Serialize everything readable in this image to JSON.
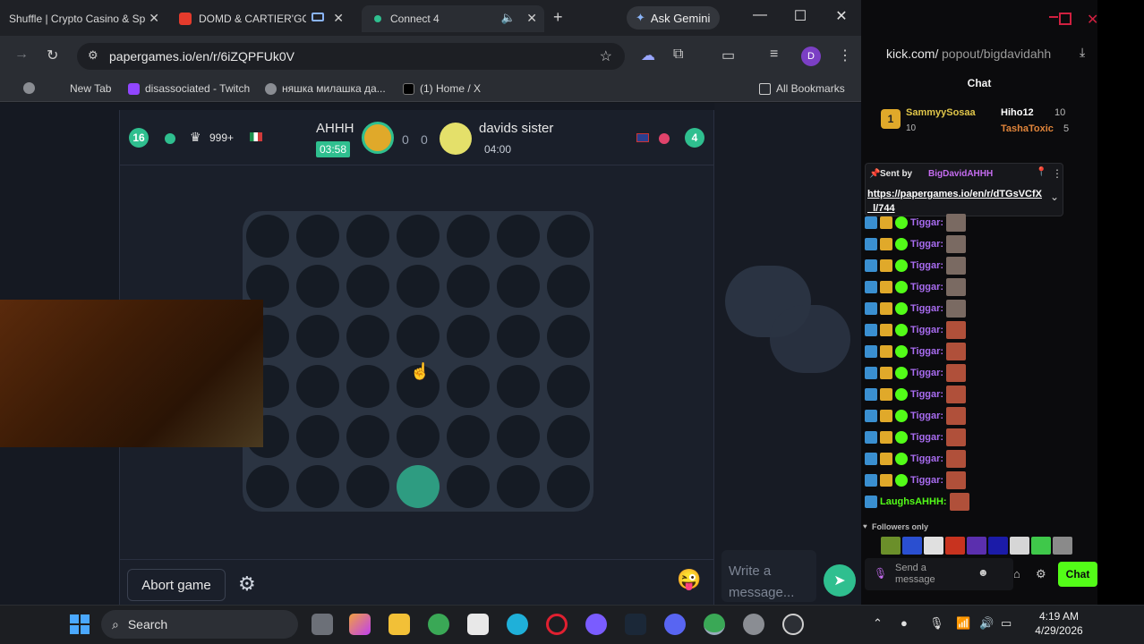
{
  "browser": {
    "tabs": [
      {
        "label": "Shuffle | Crypto Casino & Sp",
        "favicon_color": "#7a5cff"
      },
      {
        "label": "DOMD & CARTIER'GOD",
        "favicon_color": "#e53b2c"
      },
      {
        "label": "Connect 4",
        "favicon_color": "#2fbf8f"
      }
    ],
    "ask_gemini": "Ask Gemini",
    "url": "papergames.io/en/r/6iZQPFUk0V",
    "profile_initial": "D",
    "bookmarks": [
      {
        "label": "New Tab"
      },
      {
        "label": "disassociated - Twitch"
      },
      {
        "label": "няшка милашка да..."
      },
      {
        "label": "(1) Home / X"
      }
    ],
    "all_bookmarks": "All Bookmarks"
  },
  "game": {
    "player1": {
      "level": "16",
      "crown": "999+",
      "name": "AHHH",
      "timer": "03:58",
      "score": "0"
    },
    "player2": {
      "level": "4",
      "name": "davids sister",
      "timer": "04:00",
      "score": "0"
    },
    "board": {
      "rows": 6,
      "cols": 7,
      "pieces": [
        {
          "row": 5,
          "col": 3,
          "color": "teal"
        }
      ]
    },
    "abort_label": "Abort game",
    "chat_placeholder": "Write a message..."
  },
  "kick": {
    "url_prefix": "kick.com/",
    "url_path": "popout/bigdavidahh",
    "title": "Chat",
    "leaderboard": [
      {
        "rank": "1",
        "name": "SammyySosaa",
        "points": "10"
      },
      {
        "name": "Hiho12",
        "points": "10"
      },
      {
        "name": "TashaToxic",
        "points": "5"
      }
    ],
    "pinned": {
      "sent_by_label": "Sent by",
      "sender": "BigDavidAHHH",
      "link": "https://papergames.io/en/r/dTGsVCfX_l/744"
    },
    "messages": [
      {
        "user": "Tiggar:"
      },
      {
        "user": "Tiggar:"
      },
      {
        "user": "Tiggar:"
      },
      {
        "user": "Tiggar:"
      },
      {
        "user": "Tiggar:"
      },
      {
        "user": "Tiggar:"
      },
      {
        "user": "Tiggar:"
      },
      {
        "user": "Tiggar:"
      },
      {
        "user": "Tiggar:"
      },
      {
        "user": "Tiggar:"
      },
      {
        "user": "Tiggar:"
      },
      {
        "user": "Tiggar:"
      },
      {
        "user": "Tiggar:"
      },
      {
        "user": "LaughsAHHH:"
      }
    ],
    "followers_only": "Followers only",
    "send_placeholder": "Send a message",
    "chat_button": "Chat"
  },
  "taskbar": {
    "search_label": "Search",
    "time": "4:19 AM",
    "date": "4/29/2026"
  }
}
